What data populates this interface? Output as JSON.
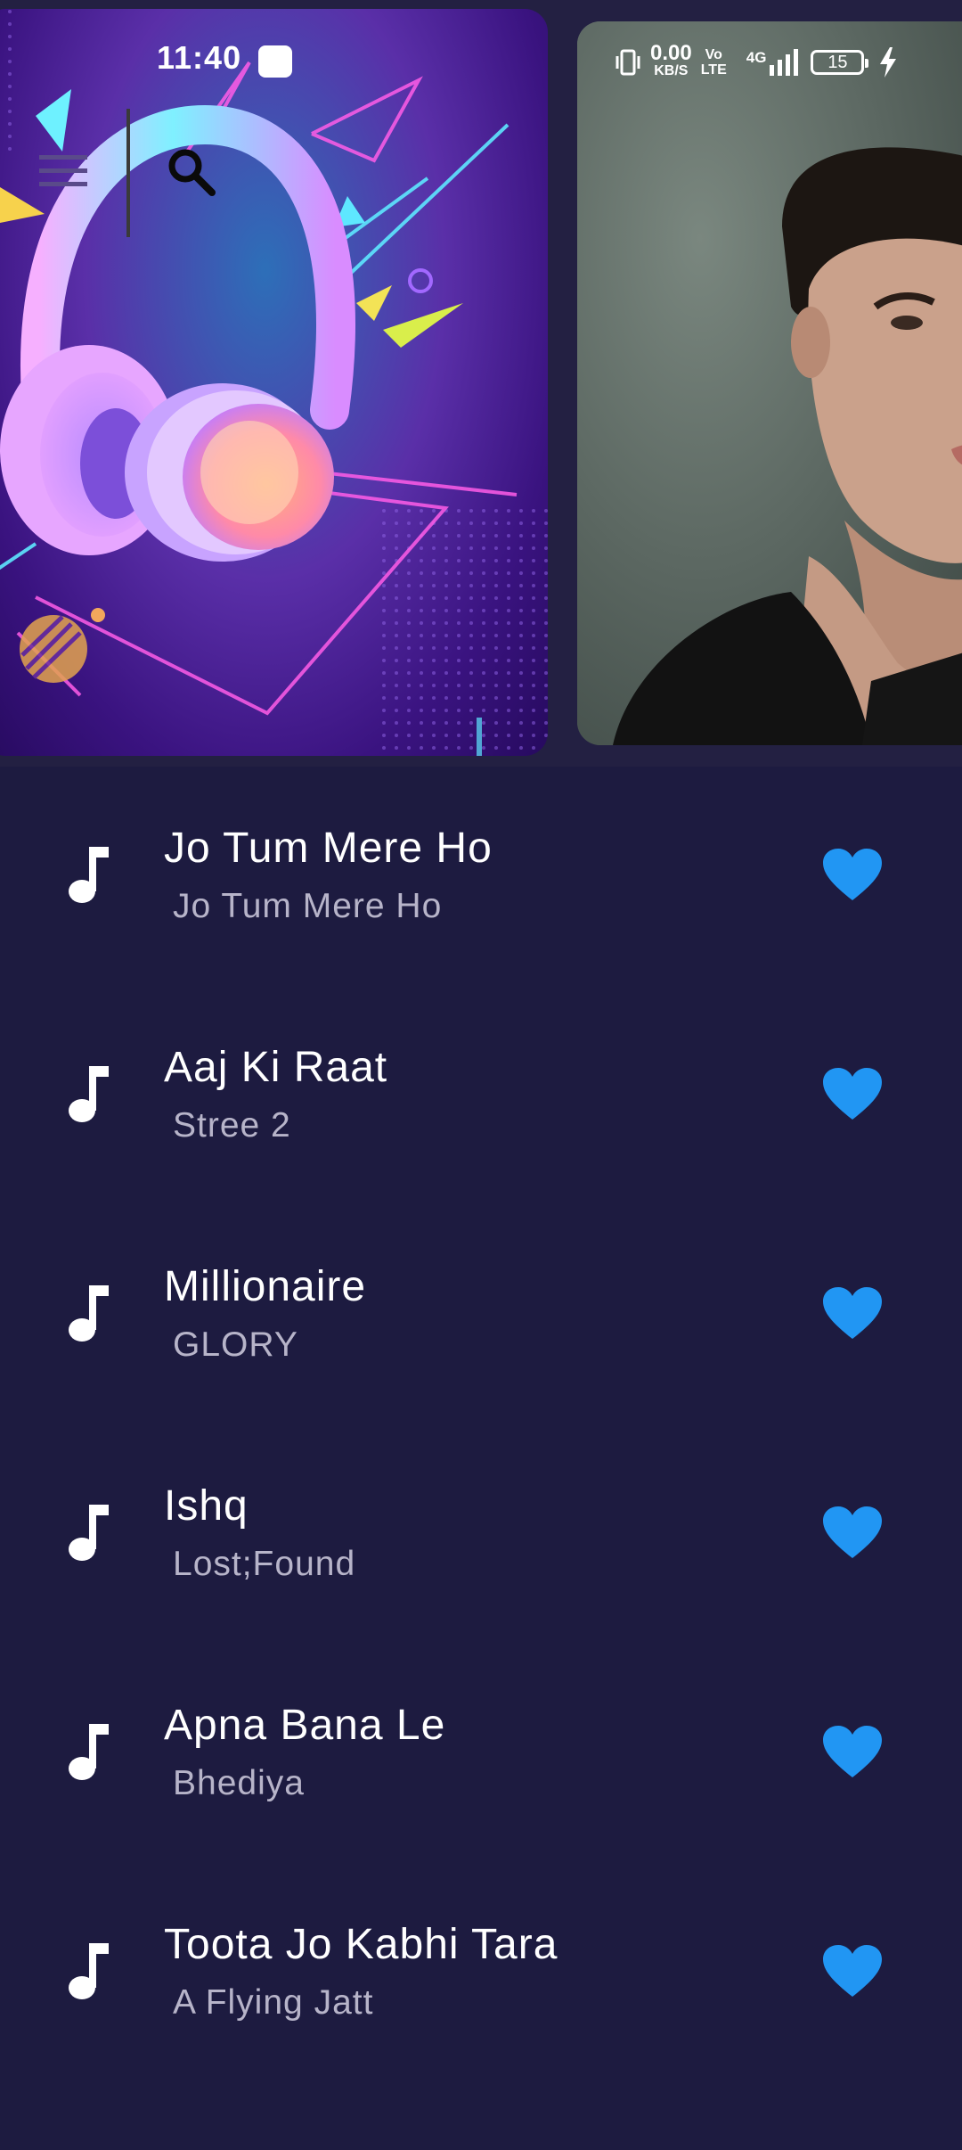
{
  "status_bar": {
    "time": "11:40",
    "net_speed": "0.00",
    "net_unit": "KB/S",
    "volte_top": "Vo",
    "volte_bottom": "LTE",
    "network": "4G",
    "battery": "15"
  },
  "app_bar": {
    "menu_icon": "hamburger-menu-icon",
    "search_icon": "search-icon"
  },
  "banner": {
    "cards": [
      {
        "image": "headphones-artwork"
      },
      {
        "image": "artist-portrait"
      }
    ]
  },
  "colors": {
    "background": "#1d1b40",
    "favorite": "#2196f3",
    "subtitle": "#b7b4c9"
  },
  "songs": [
    {
      "title": "Jo Tum Mere Ho",
      "subtitle": "Jo Tum Mere Ho",
      "favorite": true
    },
    {
      "title": "Aaj Ki Raat",
      "subtitle": "Stree 2",
      "favorite": true
    },
    {
      "title": "Millionaire",
      "subtitle": "GLORY",
      "favorite": true
    },
    {
      "title": "Ishq",
      "subtitle": "Lost;Found",
      "favorite": true
    },
    {
      "title": "Apna Bana Le",
      "subtitle": "Bhediya",
      "favorite": true
    },
    {
      "title": "Toota Jo Kabhi Tara",
      "subtitle": "A Flying Jatt",
      "favorite": true
    }
  ]
}
